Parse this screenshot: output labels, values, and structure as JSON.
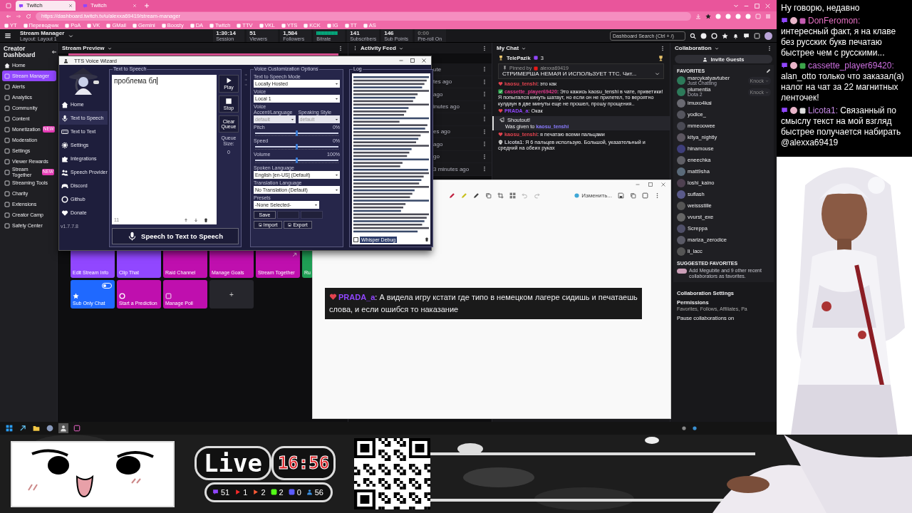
{
  "browser": {
    "tabs": [
      {
        "label": "Twitch",
        "selected": true
      },
      {
        "label": "Twitch",
        "selected": false
      }
    ],
    "url": "https://dashboard.twitch.tv/u/alexxa69419/stream-manager",
    "bookmarks": [
      "YT",
      "Переводчик",
      "PoA",
      "VK",
      "GMail",
      "Gemini",
      "Boosty",
      "DA",
      "Twitch",
      "TTV",
      "VKL",
      "YTS",
      "KCK",
      "IG",
      "TT",
      "AS"
    ]
  },
  "header": {
    "title": "Stream Manager",
    "subtitle": "Layout: Layout 1",
    "stats": [
      {
        "kind": "text",
        "value": "1:30:14",
        "label": "Session"
      },
      {
        "kind": "text",
        "value": "51",
        "label": "Viewers"
      },
      {
        "kind": "text",
        "value": "1,584",
        "label": "Followers"
      },
      {
        "kind": "graph",
        "label": "Bitrate"
      },
      {
        "kind": "text",
        "value": "141",
        "label": "Subscribers"
      },
      {
        "kind": "text",
        "value": "146",
        "label": "Sub Points"
      },
      {
        "kind": "muted",
        "value": "0:00",
        "label": "Pre-roll On"
      }
    ],
    "search": {
      "placeholder": "Dashboard Search (Ctrl + /)"
    }
  },
  "sidebar": {
    "title": "Creator Dashboard",
    "items": [
      {
        "label": "Home",
        "selected": false
      },
      {
        "label": "Stream Manager",
        "selected": true
      },
      {
        "label": "Alerts",
        "selected": false
      },
      {
        "label": "Analytics",
        "selected": false
      },
      {
        "label": "Community",
        "selected": false
      },
      {
        "label": "Content",
        "selected": false
      },
      {
        "label": "Monetization",
        "selected": false,
        "badge": "NEW"
      },
      {
        "label": "Moderation",
        "selected": false
      },
      {
        "label": "Settings",
        "selected": false
      },
      {
        "label": "Viewer Rewards",
        "selected": false
      },
      {
        "label": "Stream Together",
        "selected": false,
        "badge": "NEW"
      },
      {
        "label": "Streaming Tools",
        "selected": false
      },
      {
        "label": "Charity",
        "selected": false
      },
      {
        "label": "Extensions",
        "selected": false
      },
      {
        "label": "Creator Camp",
        "selected": false
      },
      {
        "label": "Safety Center",
        "selected": false
      }
    ]
  },
  "stream_preview": {
    "title": "Stream Preview",
    "quick_actions": [
      {
        "kind": "action",
        "label": "Edit Stream Info",
        "color": "#9147ff"
      },
      {
        "kind": "action",
        "label": "Clip That",
        "color": "#9147ff"
      },
      {
        "kind": "action",
        "label": "Raid Channel",
        "color": "#bf0fae"
      },
      {
        "kind": "action",
        "label": "Manage Goals",
        "color": "#bf0fae"
      },
      {
        "kind": "link",
        "label": "Stream Together",
        "color": "#bf0fae"
      },
      {
        "kind": "action",
        "label": "Ru",
        "color": "#1f9e55"
      },
      {
        "kind": "toggle",
        "label": "Sub Only Chat",
        "color": "#1f69ff",
        "on": false
      },
      {
        "kind": "action",
        "label": "Start a Prediction",
        "color": "#bf0fae"
      },
      {
        "kind": "action",
        "label": "Manage Poll",
        "color": "#bf0fae"
      },
      {
        "kind": "add",
        "label": "+"
      }
    ]
  },
  "activity_feed": {
    "title": "Activity Feed",
    "items": [
      {
        "kind": "row",
        "time": "ute"
      },
      {
        "kind": "row",
        "time": "tes ago"
      },
      {
        "kind": "row",
        "time": "ago"
      },
      {
        "kind": "row",
        "time": "inutes ago"
      },
      {
        "kind": "blank"
      },
      {
        "kind": "row",
        "time": "es ago"
      },
      {
        "kind": "row",
        "time": "ago"
      },
      {
        "kind": "row",
        "time": "go"
      },
      {
        "kind": "row",
        "time": "3 minutes ago"
      }
    ]
  },
  "chat": {
    "title": "My Chat",
    "top_chatter": {
      "name": "TelePazik",
      "count": "3"
    },
    "pinned": {
      "label": "Pinned by",
      "user": "alexxa69419",
      "text": "СТРИМЕРША НЕМАЯ И ИСПОЛЬЗУЕТ ТТС. Чит..."
    },
    "messages": [
      {
        "kind": "message",
        "badge": {
          "kind": "heart"
        },
        "user": "kaosu_tenshi",
        "color": "#e2434f",
        "text": ": это как"
      },
      {
        "kind": "message",
        "badge": {
          "kind": "check"
        },
        "user": "cassette_player69420",
        "color": "#e03a8c",
        "text": ": Это кажись kaosu_tenshi в чате, приветики! Я попытался кинуть шатаут, но если он не прилетел, то вероятно кулдаун в две минуты еще не прошел, прошу прощения.."
      },
      {
        "kind": "message",
        "badge": {
          "kind": "heart"
        },
        "user": "PRADA_a",
        "color": "#9146ff",
        "text": ": Окак"
      },
      {
        "kind": "shoutout",
        "title": "Shoutout!",
        "text": "Was given to",
        "user": "kaosu_tenshi",
        "color": "#8a7cff"
      },
      {
        "kind": "message",
        "badge": {
          "kind": "heart"
        },
        "user": "kaosu_tenshi",
        "color": "#e2434f",
        "text": ": я печатаю всеми пальцами"
      },
      {
        "kind": "message",
        "badge": {
          "kind": "skull"
        },
        "user": "Licota1",
        "color": "#c8c8d0",
        "text": ": Я 6 пальцев использую. Большой, указательный и средний на обеих руках"
      }
    ]
  },
  "collaboration": {
    "title": "Collaboration",
    "invite": "Invite Guests",
    "favorites_title": "FAVORITES",
    "favorites": [
      {
        "name": "marcykatyavtuber",
        "status": "Just Chatting",
        "action": "Knock"
      },
      {
        "name": "plumentia",
        "status": "Dota 2",
        "action": "Knock"
      },
      {
        "name": "imuxo4kai"
      },
      {
        "name": "yodice_"
      },
      {
        "name": "mmeoowee"
      },
      {
        "name": "kitya_nightly"
      },
      {
        "name": "hinamouse"
      },
      {
        "name": "eneechka"
      },
      {
        "name": "matt9sha"
      },
      {
        "name": "loshi_kaino"
      },
      {
        "name": "suflash"
      },
      {
        "name": "weissstille"
      },
      {
        "name": "vvurst_exe"
      },
      {
        "name": "Screppa"
      },
      {
        "name": "mariza_zerodice"
      },
      {
        "name": "li_lacc"
      }
    ],
    "suggested_title": "SUGGESTED FAVORITES",
    "suggested_text": "Add Megubite and 9 other recent collaborators as favorites.",
    "settings_title": "Collaboration Settings",
    "permissions_title": "Permissions",
    "permissions_text": "Favorites, Follows, Affiliates, Pa",
    "pause_text": "Pause collaborations on"
  },
  "tts_window": {
    "title": "TTS Voice Wizard",
    "nav": [
      {
        "kind": "house",
        "label": "Home",
        "selected": false
      },
      {
        "kind": "mic",
        "label": "Text to Speech",
        "selected": true
      },
      {
        "kind": "keyboard",
        "label": "Text to Text",
        "selected": false
      },
      {
        "kind": "gear",
        "label": "Settings",
        "selected": false
      },
      {
        "kind": "puzzle",
        "label": "Integrations",
        "selected": false
      },
      {
        "kind": "people",
        "label": "Speech Provider",
        "selected": false
      },
      {
        "kind": "gamepad",
        "label": "Discord",
        "selected": false
      },
      {
        "kind": "ring",
        "label": "Github",
        "selected": false
      },
      {
        "kind": "heart",
        "label": "Donate",
        "selected": false
      }
    ],
    "version": "v1.7.7.8",
    "tts_group": "Text to Speech",
    "text_value": "проблема бл",
    "char_count": "11",
    "side_buttons": [
      {
        "kind": "play",
        "label": "Play"
      },
      {
        "kind": "stop",
        "label": "Stop"
      },
      {
        "kind": "text",
        "label": "Clear Queue"
      }
    ],
    "queue_label": "Queue Size:",
    "queue_value": "0",
    "main_button": "Speech to Text to Speech",
    "options_group": "Voice Customization Options",
    "fields": [
      {
        "kind": "select",
        "label": "Text to Speech Mode",
        "value": "Locally Hosted",
        "disabled": false
      },
      {
        "kind": "select",
        "label": "Voice",
        "value": "Local 1",
        "disabled": false
      },
      {
        "kind": "pair",
        "items": [
          {
            "label": "Voice Accent/Language",
            "value": "default",
            "disabled": true
          },
          {
            "label": "Speaking Style",
            "value": "default",
            "disabled": true
          }
        ]
      },
      {
        "kind": "slider",
        "label": "Pitch",
        "reading": "0%",
        "level": 0.5
      },
      {
        "kind": "slider",
        "label": "Speed",
        "reading": "0%",
        "level": 0.5
      },
      {
        "kind": "slider",
        "label": "Volume",
        "reading": "100%",
        "level": 0.5
      },
      {
        "kind": "select",
        "label": "Spoken Language",
        "value": "English [en-US] (Default)",
        "disabled": false
      },
      {
        "kind": "select",
        "label": "Translation Language",
        "value": "No Translation (Default)",
        "disabled": false
      },
      {
        "kind": "preset",
        "label": "Presets",
        "value": "-None Selected-",
        "disabled": false
      }
    ],
    "preset_buttons": [
      {
        "label": "Save",
        "disabled": false
      },
      {
        "disabled": true
      },
      {
        "disabled": true
      }
    ],
    "file_buttons": [
      "Import",
      "Export"
    ],
    "log_group": "Log",
    "debug": {
      "label": "Whisper Debug",
      "checked": false
    }
  },
  "snip_window": {
    "edit_label": "Изменить...",
    "message": {
      "user": "PRADA_a",
      "color": "#9146ff",
      "text": ": А видела игру кстати где типо в немецком лагере сидишь и печатаешь слова, и если ошибся то наказание"
    }
  },
  "overlay_chat": [
    {
      "kind": "continuation",
      "text": "Ну говорю, недавно"
    },
    {
      "kind": "message",
      "user": "DonFeromon:",
      "color": "#e46fc0",
      "text": "интересный факт, я на клаве без русских букв печатаю быстрее чем с русскими..."
    },
    {
      "kind": "message",
      "user": "cassette_player69420:",
      "color": "#cc6fe0",
      "text": "alan_otto только что заказал(а) налог на чат за 22 магнитных ленточек!"
    },
    {
      "kind": "message",
      "user": "Licota1:",
      "color": "#c78ae6",
      "text": "Связанный по смыслу текст на мой взгляд быстрее получается набирать @alexxa69419"
    }
  ],
  "live_widget": {
    "label": "Live",
    "time": "16:56",
    "counts": [
      {
        "kind": "twitch",
        "value": "51"
      },
      {
        "kind": "youtube",
        "value": "1"
      },
      {
        "kind": "vk",
        "value": "2"
      },
      {
        "kind": "kick",
        "value": "2"
      },
      {
        "kind": "vkl",
        "value": "0"
      },
      {
        "kind": "viewers",
        "value": "56"
      }
    ]
  }
}
